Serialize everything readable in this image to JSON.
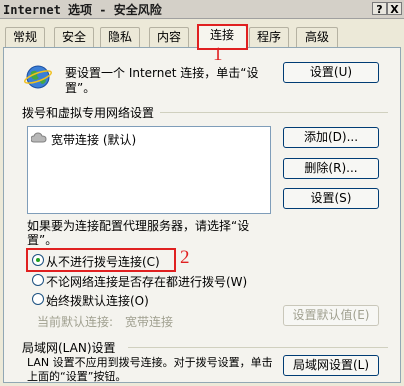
{
  "window": {
    "title": "Internet 选项 - 安全风险",
    "help_btn": "?",
    "close_btn": "X"
  },
  "tabs": [
    "常规",
    "安全",
    "隐私",
    "内容",
    "连接",
    "程序",
    "高级"
  ],
  "annotations": {
    "tab_number": "1",
    "radio_number": "2",
    "color": "#e02020"
  },
  "setup": {
    "text": "要设置一个 Internet 连接，单击“设置”。",
    "button": "设置(U)"
  },
  "dialup": {
    "heading": "拨号和虚拟专用网络设置",
    "connections": [
      "宽带连接 (默认)"
    ],
    "add_button": "添加(D)...",
    "remove_button": "删除(R)...",
    "settings_button": "设置(S)"
  },
  "proxy_note": "如果要为连接配置代理服务器，请选择“设置”。",
  "options": {
    "never": "从不进行拨号连接(C)",
    "when_no_network": "不论网络连接是否存在都进行拨号(W)",
    "always": "始终拨默认连接(O)",
    "selected": "never"
  },
  "default_conn": {
    "label": "当前默认连接:",
    "value": "宽带连接",
    "button": "设置默认值(E)"
  },
  "lan": {
    "heading": "局域网(LAN)设置",
    "text": "LAN 设置不应用到拨号连接。对于拨号设置，单击上面的“设置”按钮。",
    "button": "局域网设置(L)"
  }
}
